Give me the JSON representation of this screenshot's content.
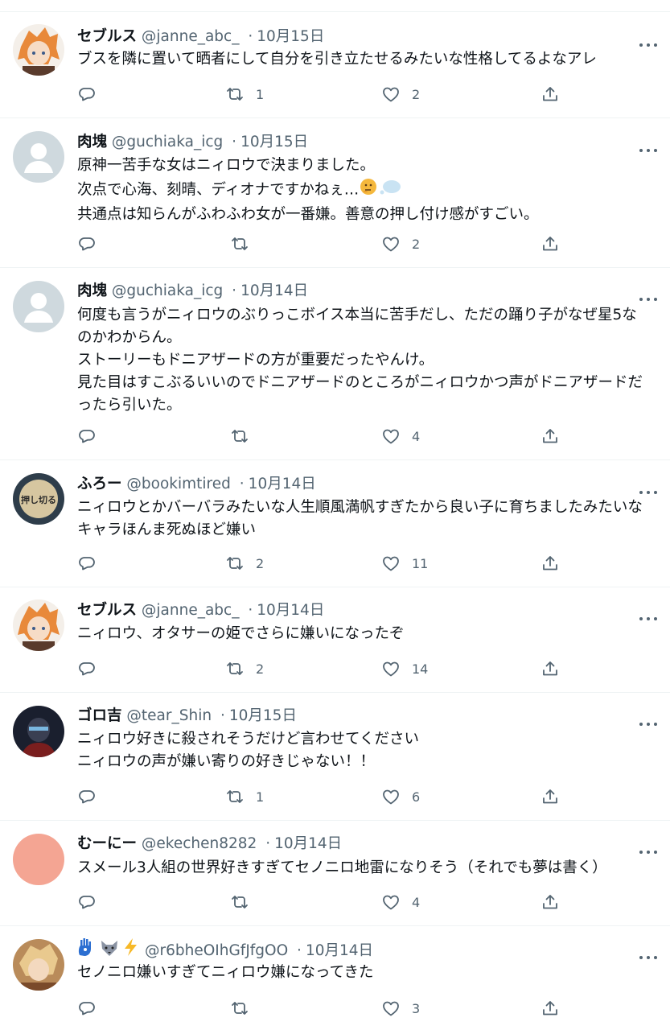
{
  "colors": {
    "text": "#0f1419",
    "secondary": "#536471",
    "divider": "#eff3f4"
  },
  "icons": [
    "reply-icon",
    "retweet-icon",
    "like-icon",
    "share-icon",
    "more-icon"
  ],
  "tweets": [
    {
      "name": "セブルス",
      "handle": "@janne_abc_",
      "dot": "·",
      "date": "10月15日",
      "lines": [
        "ブスを隣に置いて晒者にして自分を引き立たせるみたいな性格してるよなアレ"
      ],
      "retweets": "1",
      "likes": "2"
    },
    {
      "name": "肉塊",
      "handle": "@guchiaka_icg",
      "dot": "·",
      "date": "10月15日",
      "lines": [
        "原神一苦手な女はニィロウで決まりました。",
        "次点で心海、刻晴、ディオナですかねぇ…",
        "共通点は知らんがふわふわ女が一番嫌。善意の押し付け感がすごい。"
      ],
      "retweets": "",
      "likes": "2"
    },
    {
      "name": "肉塊",
      "handle": "@guchiaka_icg",
      "dot": "·",
      "date": "10月14日",
      "lines": [
        "何度も言うがニィロウのぶりっこボイス本当に苦手だし、ただの踊り子がなぜ星5な",
        "のかわからん。",
        "ストーリーもドニアザードの方が重要だったやんけ。",
        "見た目はすこぶるいいのでドニアザードのところがニィロウかつ声がドニアザードだ",
        "ったら引いた。"
      ],
      "retweets": "",
      "likes": "4"
    },
    {
      "name": "ふろー",
      "handle": "@bookimtired",
      "dot": "·",
      "date": "10月14日",
      "avatar_text": "押し切る",
      "lines": [
        "ニィロウとかバーバラみたいな人生順風満帆すぎたから良い子に育ちましたみたいな",
        "キャラほんま死ぬほど嫌い"
      ],
      "retweets": "2",
      "likes": "11"
    },
    {
      "name": "セブルス",
      "handle": "@janne_abc_",
      "dot": "·",
      "date": "10月14日",
      "lines": [
        "ニィロウ、オタサーの姫でさらに嫌いになったぞ"
      ],
      "retweets": "2",
      "likes": "14"
    },
    {
      "name": "ゴロ吉",
      "handle": "@tear_Shin",
      "dot": "·",
      "date": "10月15日",
      "lines": [
        "ニィロウ好きに殺されそうだけど言わせてください",
        "ニィロウの声が嫌い寄りの好きじゃない！！"
      ],
      "retweets": "1",
      "likes": "6"
    },
    {
      "name": "むーにー",
      "handle": "@ekechen8282",
      "dot": "·",
      "date": "10月14日",
      "lines": [
        "スメール3人組の世界好きすぎてセノニロ地雷になりそう（それでも夢は書く）"
      ],
      "retweets": "",
      "likes": "4"
    },
    {
      "name": "",
      "handle": "@r6bheOIhGfJfgOO",
      "dot": "·",
      "date": "10月14日",
      "name_emojis": [
        "hamsa-emoji",
        "wolf-emoji",
        "lightning-emoji"
      ],
      "lines": [
        "セノニロ嫌いすぎてニィロウ嫌になってきた"
      ],
      "retweets": "",
      "likes": "3"
    }
  ]
}
